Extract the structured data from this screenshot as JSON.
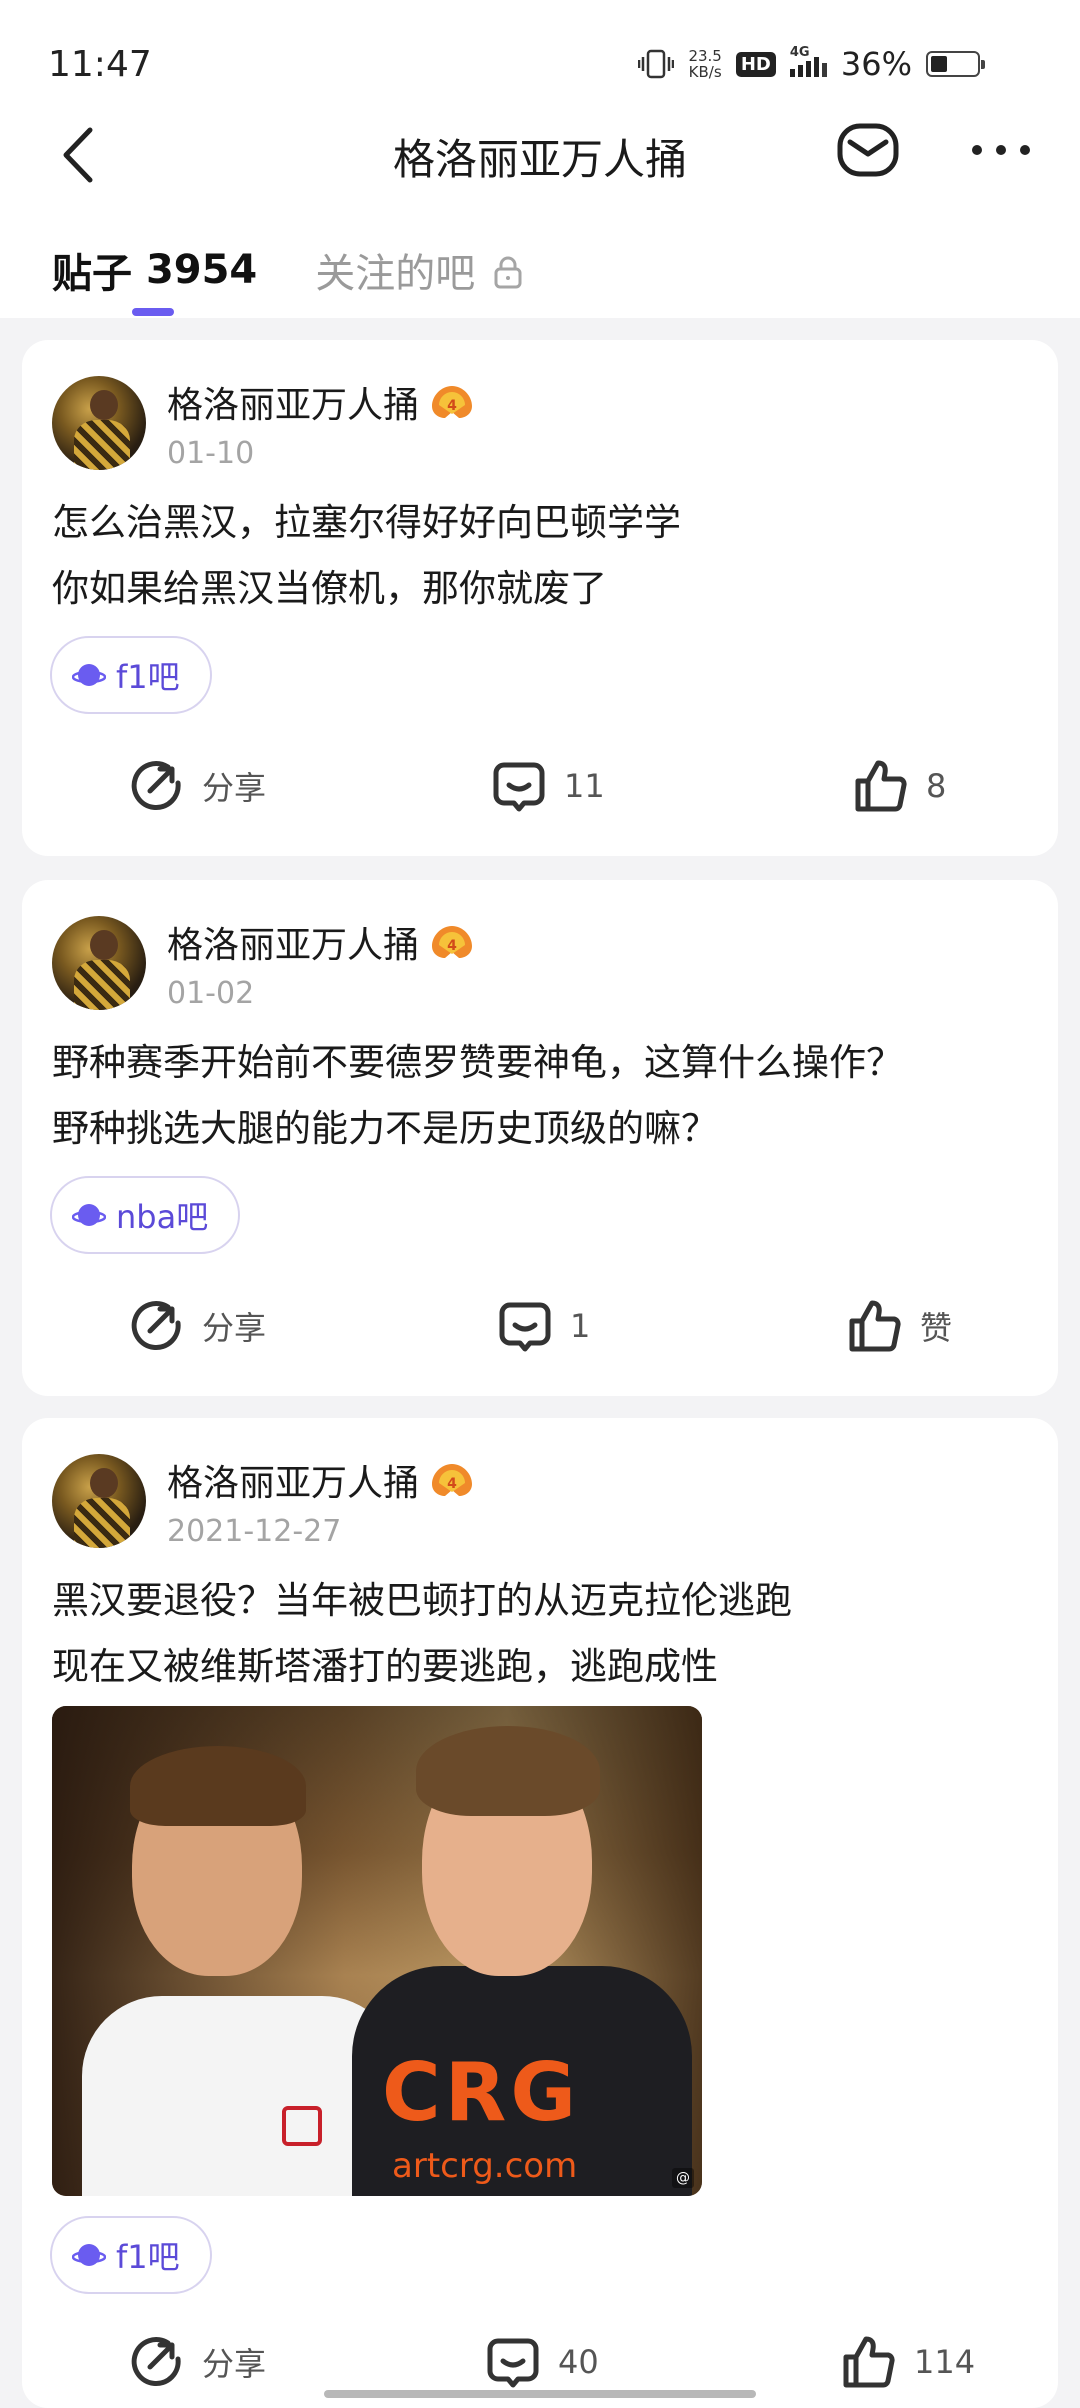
{
  "status_bar": {
    "time": "11:47",
    "net_speed_value": "23.5",
    "net_speed_unit": "KB/s",
    "hd_label": "HD",
    "network_type": "4G",
    "battery_percent": "36%",
    "battery_level": 0.36
  },
  "nav": {
    "title": "格洛丽亚万人捅",
    "back_icon": "chevron-left-icon",
    "message_icon": "mail-icon",
    "more_icon": "more-icon"
  },
  "tabs": {
    "posts_label": "贴子",
    "posts_count": "3954",
    "following_label": "关注的吧"
  },
  "colors": {
    "accent": "#6a5cf0",
    "forum_text": "#5b4ad8",
    "background": "#f3f3f5"
  },
  "posts": [
    {
      "author": "格洛丽亚万人捅",
      "date": "01-10",
      "lines": [
        "怎么治黑汉，拉塞尔得好好向巴顿学学",
        "你如果给黑汉当僚机，那你就废了"
      ],
      "forum": "f1吧",
      "share_label": "分享",
      "comment_count": "11",
      "like_label": "8"
    },
    {
      "author": "格洛丽亚万人捅",
      "date": "01-02",
      "lines": [
        "野种赛季开始前不要德罗赞要神龟，这算什么操作？",
        "野种挑选大腿的能力不是历史顶级的嘛？"
      ],
      "forum": "nba吧",
      "share_label": "分享",
      "comment_count": "1",
      "like_label": "赞"
    },
    {
      "author": "格洛丽亚万人捅",
      "date": "2021-12-27",
      "lines": [
        "黑汉要退役？当年被巴顿打的从迈克拉伦逃跑",
        "现在又被维斯塔潘打的要逃跑，逃跑成性"
      ],
      "photo_text_1": "CRG",
      "photo_text_2": "artcrg.com",
      "forum": "f1吧",
      "share_label": "分享",
      "comment_count": "40",
      "like_label": "114"
    }
  ]
}
